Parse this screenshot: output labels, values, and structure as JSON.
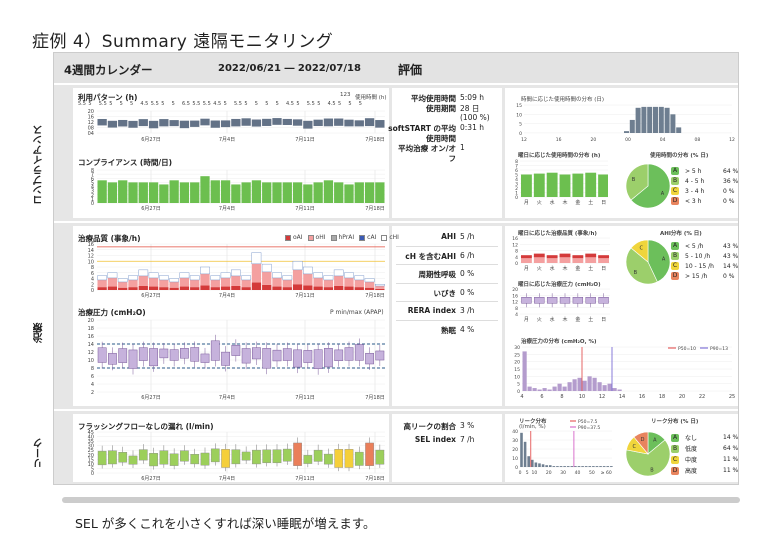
{
  "slide_title": "症例 4）Summary 遠隔モニタリング",
  "header": {
    "calendar_title": "4週間カレンダー",
    "date_range": "2022/06/21 ― 2022/07/18",
    "eval_title": "評価"
  },
  "sections": {
    "compliance": "コンプライアンス",
    "treatment": "治療",
    "leak": "リーク"
  },
  "charts_left": {
    "usage_pattern": {
      "title": "利用パターン (h)",
      "legend": "使用時間 (h)",
      "legend_num": "123",
      "hours": [
        "5.5",
        "5",
        "5.5",
        "5",
        "5",
        "5",
        "4.5",
        "5.5",
        "5",
        "5",
        "6.5",
        "5.5",
        "5.5",
        "4.5",
        "5",
        "5.5",
        "5",
        "5",
        "5",
        "5",
        "4.5",
        "5",
        "5.5",
        "5",
        "4.5",
        "5",
        "5",
        "5"
      ]
    },
    "compliance": {
      "title": "コンプライアンス (時間/日)",
      "ylim": [
        0,
        8
      ],
      "yticks": [
        "8",
        "7",
        "6",
        "5",
        "4",
        "3",
        "2",
        "1",
        "0"
      ]
    },
    "quality": {
      "title": "治療品質 (事象/h)",
      "legend": [
        "oAI",
        "oHI",
        "hPrAI",
        "cAI",
        "cHI"
      ],
      "yticks": [
        "16",
        "14",
        "12",
        "10",
        "8",
        "6",
        "4",
        "2",
        "0"
      ]
    },
    "pressure": {
      "title": "治療圧力 (cmH₂O)",
      "legend": "P min/max (APAP)",
      "yticks": [
        "20",
        "18",
        "16",
        "14",
        "12",
        "10",
        "8",
        "6",
        "4",
        "2"
      ]
    },
    "leak": {
      "title": "フラッシングフローなしの漏れ (l/min)",
      "yticks": [
        "45",
        "40",
        "35",
        "30",
        "25",
        "20",
        "15",
        "10",
        "5",
        "0"
      ]
    },
    "xticks": [
      "6月27日",
      "7月4日",
      "7月11日",
      "7月18日"
    ]
  },
  "metrics": {
    "compliance": [
      {
        "k": "平均使用時間",
        "v": "5:09 h"
      },
      {
        "k": "使用期間",
        "v": "28 日"
      },
      {
        "k": "",
        "v": "(100 %)"
      },
      {
        "k": "softSTART の平均",
        "v": "0:31 h"
      },
      {
        "k": "使用時間",
        "v": ""
      },
      {
        "k": "平均治療 オン/オ",
        "v": "1"
      },
      {
        "k": "フ",
        "v": ""
      }
    ],
    "treatment": [
      {
        "k": "AHI",
        "v": "5 /h"
      },
      {
        "k": "cH を含むAHI",
        "v": "6 /h"
      },
      {
        "k": "周期性呼吸",
        "v": "0 %"
      },
      {
        "k": "いびき",
        "v": "0 %"
      },
      {
        "k": "RERA index",
        "v": "3 /h"
      },
      {
        "k": "熟眠",
        "v": "4 %"
      }
    ],
    "leak": [
      {
        "k": "高リークの割合",
        "v": "3 %"
      },
      {
        "k": "SEL index",
        "v": "7 /h"
      }
    ]
  },
  "right": {
    "time_dist": {
      "title": "時間に応じた使用時間の分布 (日)",
      "xticks": [
        "12",
        "16",
        "20",
        "00",
        "04",
        "08",
        "12"
      ]
    },
    "weekday_usage": {
      "title": "曜日に応じた使用時間の分布 (h)",
      "days": [
        "月",
        "火",
        "水",
        "木",
        "金",
        "土",
        "日"
      ],
      "yticks": [
        "8",
        "7",
        "6",
        "5",
        "4",
        "3",
        "2",
        "1",
        "0"
      ]
    },
    "usage_pie": {
      "title": "使用時間の分布 (% 日)",
      "letters": [
        "A",
        "B",
        "C",
        "D"
      ],
      "rows": [
        {
          "l": "A",
          "t": "> 5 h",
          "v": "64 %",
          "c": "#6cbf5b"
        },
        {
          "l": "B",
          "t": "4 - 5 h",
          "v": "36 %",
          "c": "#9ccf6b"
        },
        {
          "l": "C",
          "t": "3 - 4 h",
          "v": "0 %",
          "c": "#f0d53c"
        },
        {
          "l": "D",
          "t": "< 3 h",
          "v": "0 %",
          "c": "#e8845e"
        }
      ]
    },
    "weekday_quality": {
      "title": "曜日に応じた治療品質 (事象/h)",
      "days": [
        "月",
        "火",
        "水",
        "木",
        "金",
        "土",
        "日"
      ],
      "yticks": [
        "16",
        "12",
        "8",
        "4",
        "0"
      ]
    },
    "weekday_pressure": {
      "title": "曜日に応じた治療圧力 (cmH₂O)",
      "yticks": [
        "20",
        "16",
        "12",
        "8",
        "4"
      ]
    },
    "ahi_pie": {
      "title": "AHI分布 (% 日)",
      "letters": [
        "A",
        "B",
        "C"
      ],
      "rows": [
        {
          "l": "A",
          "t": "< 5 /h",
          "v": "43 %",
          "c": "#6cbf5b"
        },
        {
          "l": "B",
          "t": "5 - 10 /h",
          "v": "43 %",
          "c": "#9ccf6b"
        },
        {
          "l": "C",
          "t": "10 - 15 /h",
          "v": "14 %",
          "c": "#f0d53c"
        },
        {
          "l": "D",
          "t": "> 15 /h",
          "v": "0 %",
          "c": "#e8845e"
        }
      ]
    },
    "pressure_dist": {
      "title": "治療圧力の分布 (cmH₂O, %)",
      "p50": "P50=10",
      "p90": "P90=13",
      "xticks": [
        "4",
        "6",
        "8",
        "10",
        "12",
        "14",
        "16",
        "18",
        "20",
        "22",
        "25"
      ],
      "yticks": [
        "30",
        "25",
        "20",
        "15",
        "10",
        "5",
        "0"
      ]
    },
    "leak_dist": {
      "title": "リーク分布",
      "unit": "(l/min, %)",
      "p50": "P50=7.5",
      "p90": "P90=37.5",
      "xticks": [
        "0",
        "5",
        "10",
        "20",
        "30",
        "40",
        "50",
        "≥ 60"
      ],
      "yticks": [
        "40",
        "30",
        "20",
        "10",
        "0"
      ]
    },
    "leak_pie": {
      "title": "リーク分布 (% 日)",
      "letters": [
        "A",
        "B",
        "C",
        "D"
      ],
      "rows": [
        {
          "l": "A",
          "t": "なし",
          "v": "14 %",
          "c": "#6cbf5b"
        },
        {
          "l": "B",
          "t": "低度",
          "v": "64 %",
          "c": "#9ccf6b"
        },
        {
          "l": "C",
          "t": "中度",
          "v": "11 %",
          "c": "#f0d53c"
        },
        {
          "l": "D",
          "t": "高度",
          "v": "11 %",
          "c": "#e8845e"
        }
      ]
    }
  },
  "caption": "SEL が多くこれを小さくすれば深い睡眠が増えます。"
}
